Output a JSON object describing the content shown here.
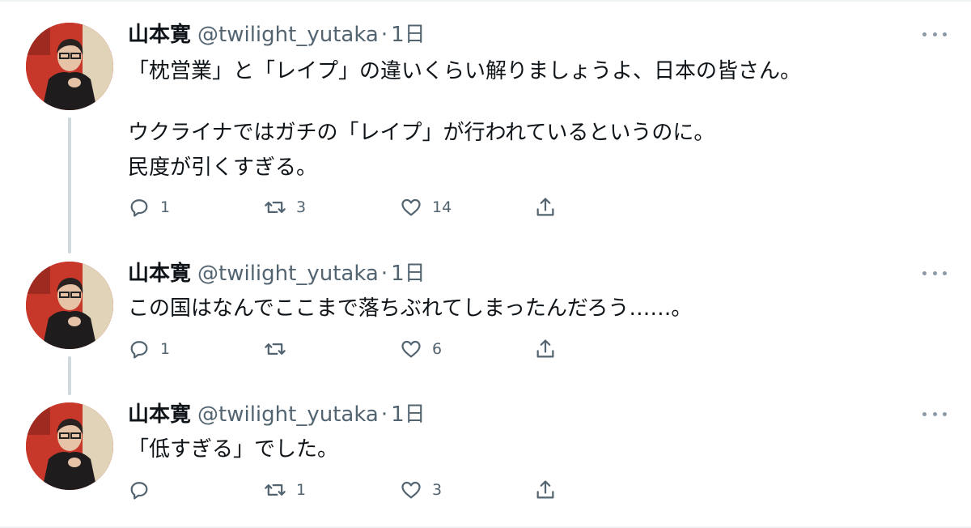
{
  "tweets": [
    {
      "author_name": "山本寛",
      "handle": "@twilight_yutaka",
      "separator": "·",
      "time": "1日",
      "lines": [
        "「枕営業」と「レイプ」の違いくらい解りましょうよ、日本の皆さん。",
        "",
        "ウクライナではガチの「レイプ」が行われているというのに。",
        "民度が引くすぎる。"
      ],
      "reply_count": "1",
      "retweet_count": "3",
      "like_count": "14"
    },
    {
      "author_name": "山本寛",
      "handle": "@twilight_yutaka",
      "separator": "·",
      "time": "1日",
      "lines": [
        "この国はなんでここまで落ちぶれてしまったんだろう……。"
      ],
      "reply_count": "1",
      "retweet_count": "",
      "like_count": "6"
    },
    {
      "author_name": "山本寛",
      "handle": "@twilight_yutaka",
      "separator": "·",
      "time": "1日",
      "lines": [
        "「低すぎる」でした。"
      ],
      "reply_count": "",
      "retweet_count": "1",
      "like_count": "3"
    }
  ],
  "icons": {
    "reply": "reply-icon",
    "retweet": "retweet-icon",
    "like": "heart-icon",
    "share": "share-icon",
    "more": "more-icon"
  },
  "colors": {
    "text": "#0f1419",
    "secondary": "#536471",
    "thread_line": "#cfd9de",
    "avatar_bg": "#c8382a"
  }
}
